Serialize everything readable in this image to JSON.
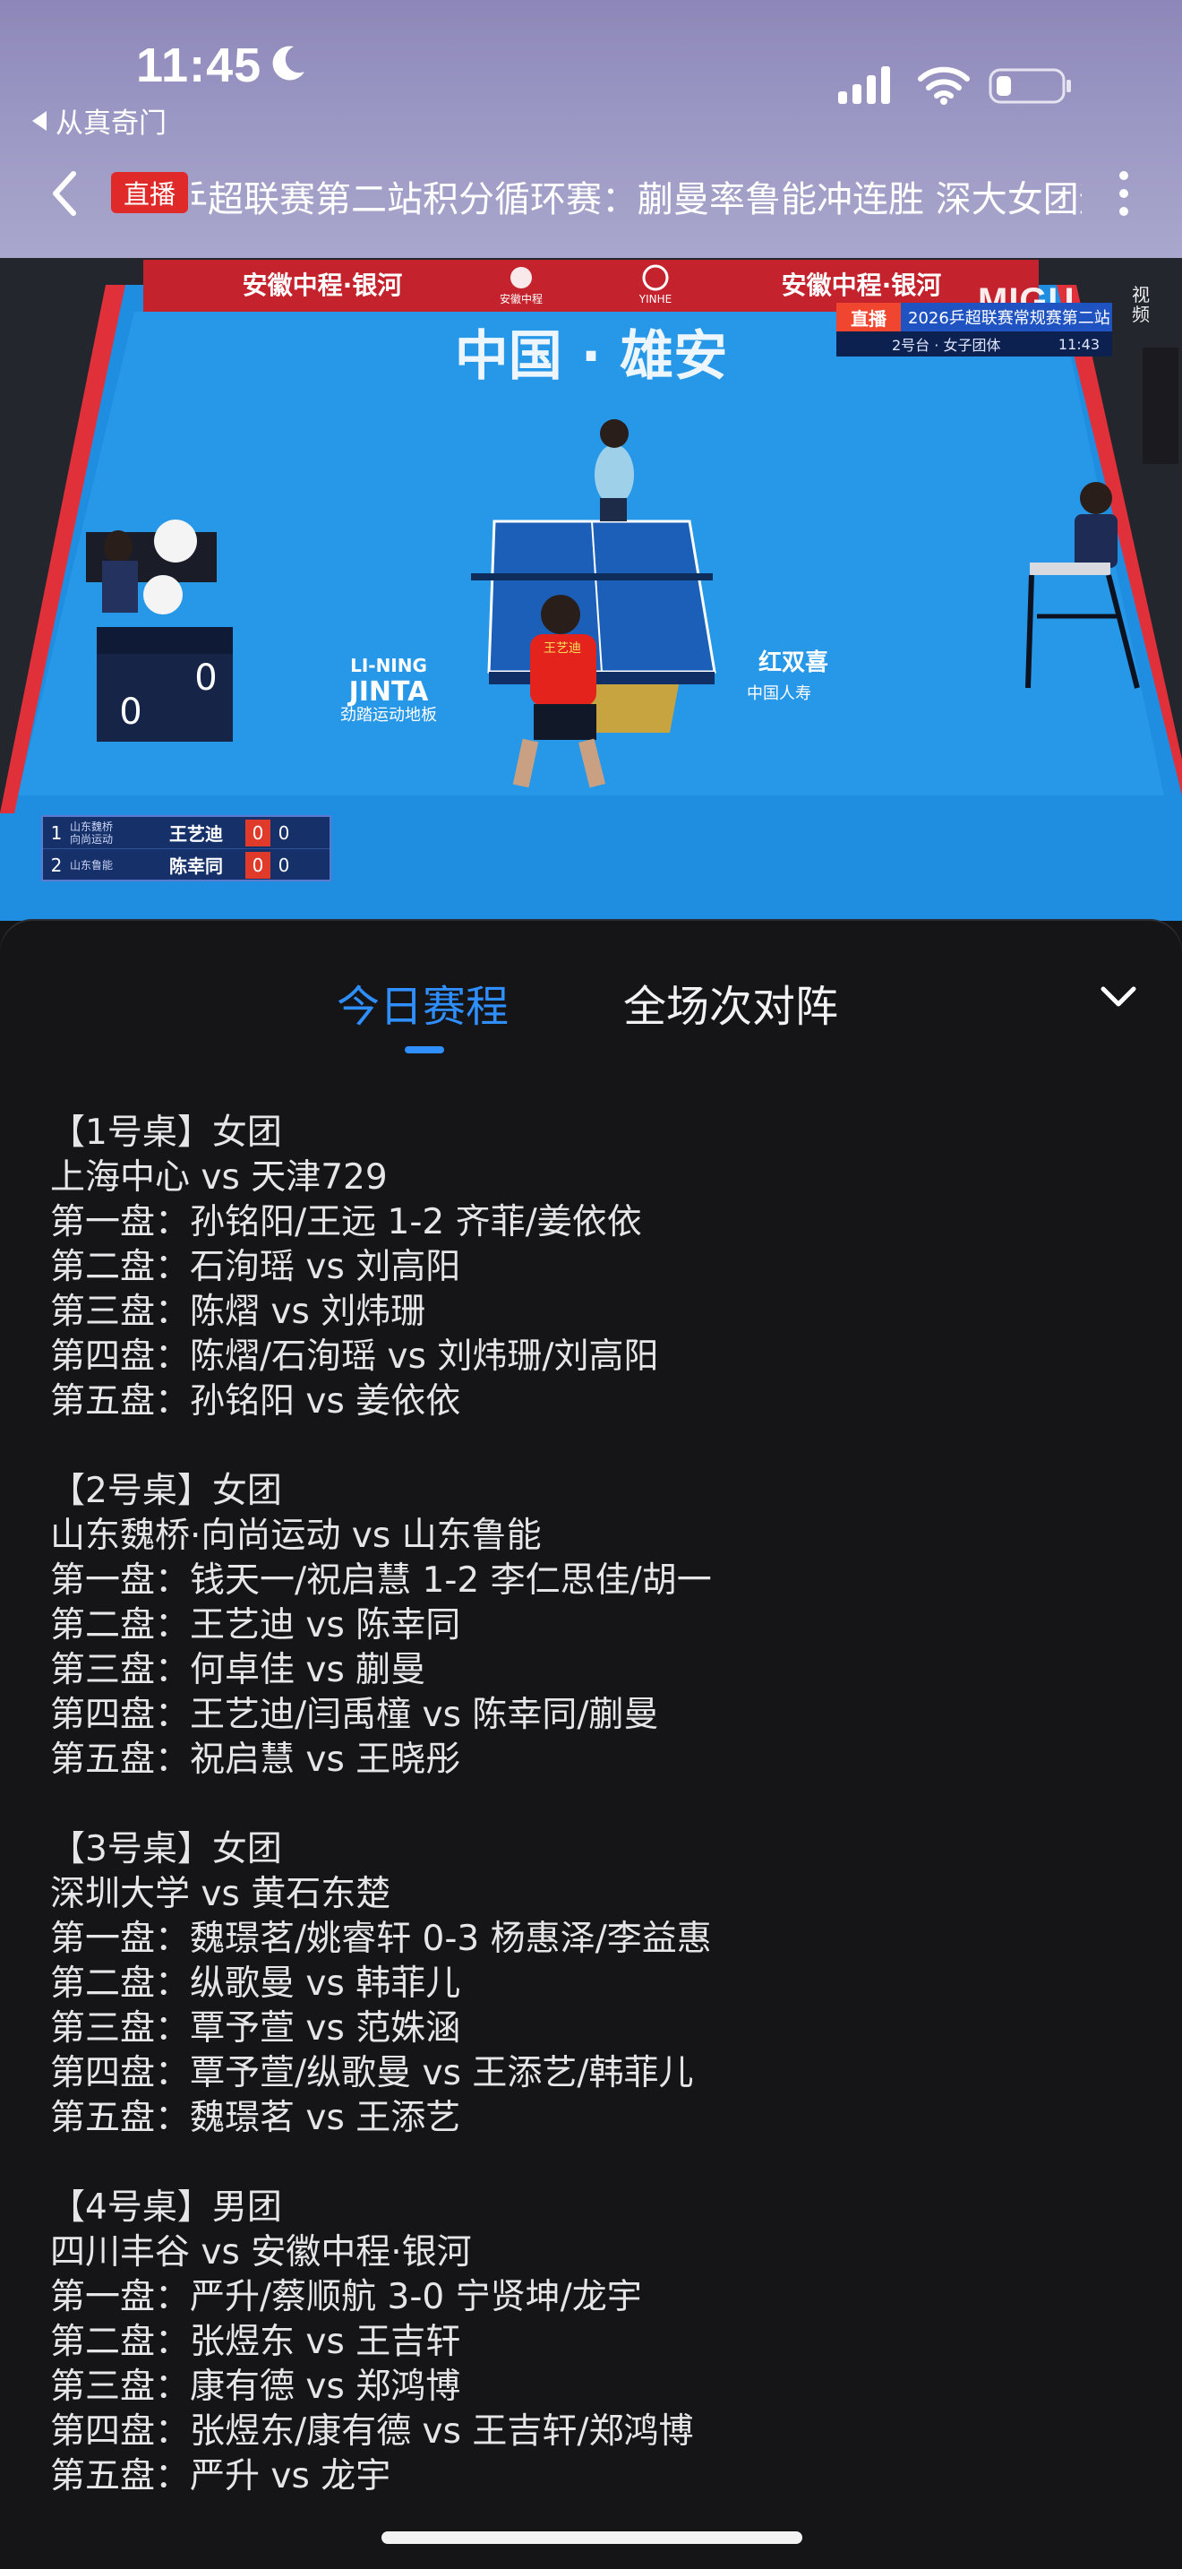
{
  "status_bar": {
    "time": "11:45",
    "back_app": "从真奇门",
    "icons": [
      "moon-icon",
      "signal-icon",
      "wifi-icon",
      "battery-icon"
    ]
  },
  "nav": {
    "live_badge": "直播",
    "title": "乒超联赛第二站积分循环赛：蒯曼率鲁能冲连胜 深大女团迎",
    "back_icon": "chevron-left-icon",
    "more_icon": "more-vertical-icon"
  },
  "video": {
    "banner_left": "安徽中程·银河",
    "banner_right": "安徽中程·银河",
    "banner_mid_a": "安徽中程",
    "banner_mid_b": "YINHE",
    "court_text": "中国 · 雄安",
    "sponsor_left_a": "LI-NING",
    "sponsor_left_b": "JINTA",
    "sponsor_left_c": "劲踏运动地板",
    "sponsor_right_a": "红双喜",
    "sponsor_right_b": "中国人寿",
    "umpire_score": [
      "0",
      "0"
    ],
    "brand": "MIGU",
    "brand_sub": "视频",
    "hud": {
      "live": "直播",
      "title": "2026乒超联赛常规赛第二站",
      "table": "2号台 · 女子团体",
      "time": "11:43"
    },
    "scoreboard": [
      {
        "idx": "1",
        "team_a": "山东魏桥",
        "team_b": "向尚运动",
        "player": "王艺迪",
        "games": "0",
        "points": "0"
      },
      {
        "idx": "2",
        "team_a": "山东鲁能",
        "team_b": "",
        "player": "陈幸同",
        "games": "0",
        "points": "0"
      }
    ],
    "jersey_name": "王艺迪"
  },
  "tabs": {
    "today": "今日赛程",
    "all": "全场次对阵",
    "collapse_icon": "chevron-down-icon"
  },
  "schedule": [
    {
      "lines": [
        "【1号桌】女团",
        "上海中心 vs 天津729",
        "第一盘：孙铭阳/王远 1-2 齐菲/姜依依",
        "第二盘：石洵瑶 vs 刘高阳",
        "第三盘：陈熠 vs 刘炜珊",
        "第四盘：陈熠/石洵瑶 vs 刘炜珊/刘高阳",
        "第五盘：孙铭阳 vs 姜依依"
      ]
    },
    {
      "lines": [
        "【2号桌】女团",
        "山东魏桥·向尚运动 vs 山东鲁能",
        "第一盘：钱天一/祝启慧 1-2 李仁思佳/胡一",
        "第二盘：王艺迪 vs 陈幸同",
        "第三盘：何卓佳 vs 蒯曼",
        "第四盘：王艺迪/闫禹橦 vs 陈幸同/蒯曼",
        "第五盘：祝启慧 vs 王晓彤"
      ]
    },
    {
      "lines": [
        "【3号桌】女团",
        "深圳大学 vs 黄石东楚",
        "第一盘：魏璟茗/姚睿轩 0-3 杨惠泽/李益惠",
        "第二盘：纵歌曼 vs 韩菲儿",
        "第三盘：覃予萱 vs 范姝涵",
        "第四盘：覃予萱/纵歌曼 vs 王添艺/韩菲儿",
        "第五盘：魏璟茗 vs 王添艺"
      ]
    },
    {
      "lines": [
        "【4号桌】男团",
        "四川丰谷 vs 安徽中程·银河",
        "第一盘：严升/蔡顺航 3-0 宁贤坤/龙宇",
        "第二盘：张煜东 vs 王吉轩",
        "第三盘：康有德 vs 郑鸿博",
        "第四盘：张煜东/康有德 vs 王吉轩/郑鸿博",
        "第五盘：严升 vs 龙宇"
      ]
    }
  ]
}
